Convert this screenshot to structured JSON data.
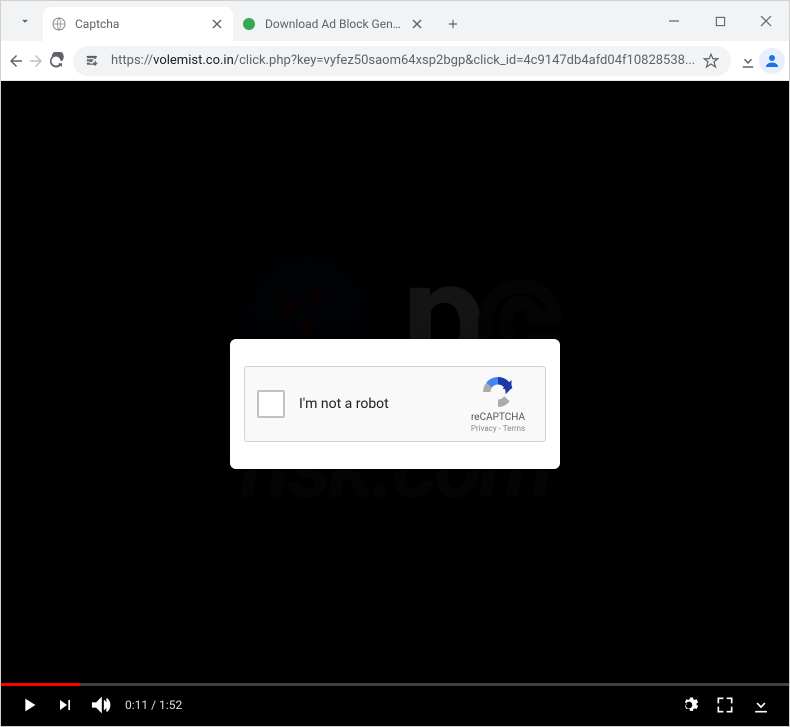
{
  "window": {
    "tabs": [
      {
        "title": "Captcha",
        "favicon": "globe",
        "active": true
      },
      {
        "title": "Download Ad Block Genius",
        "favicon": "green-dot",
        "active": false
      }
    ]
  },
  "toolbar": {
    "url_scheme": "https://",
    "url_host": "volemist.co.in",
    "url_path": "/click.php?key=vyfez50saom64xsp2bgp&click_id=4c9147db4afd04f10828538..."
  },
  "captcha": {
    "label": "I'm not a robot",
    "brand": "reCAPTCHA",
    "privacy": "Privacy",
    "terms": "Terms",
    "sep": " - "
  },
  "player": {
    "current": "0:11",
    "duration": "1:52",
    "sep": " / ",
    "progress_pct": 10
  },
  "watermark": {
    "pc_p": "p",
    "pc_c": "c",
    "sub": "risk.com"
  }
}
